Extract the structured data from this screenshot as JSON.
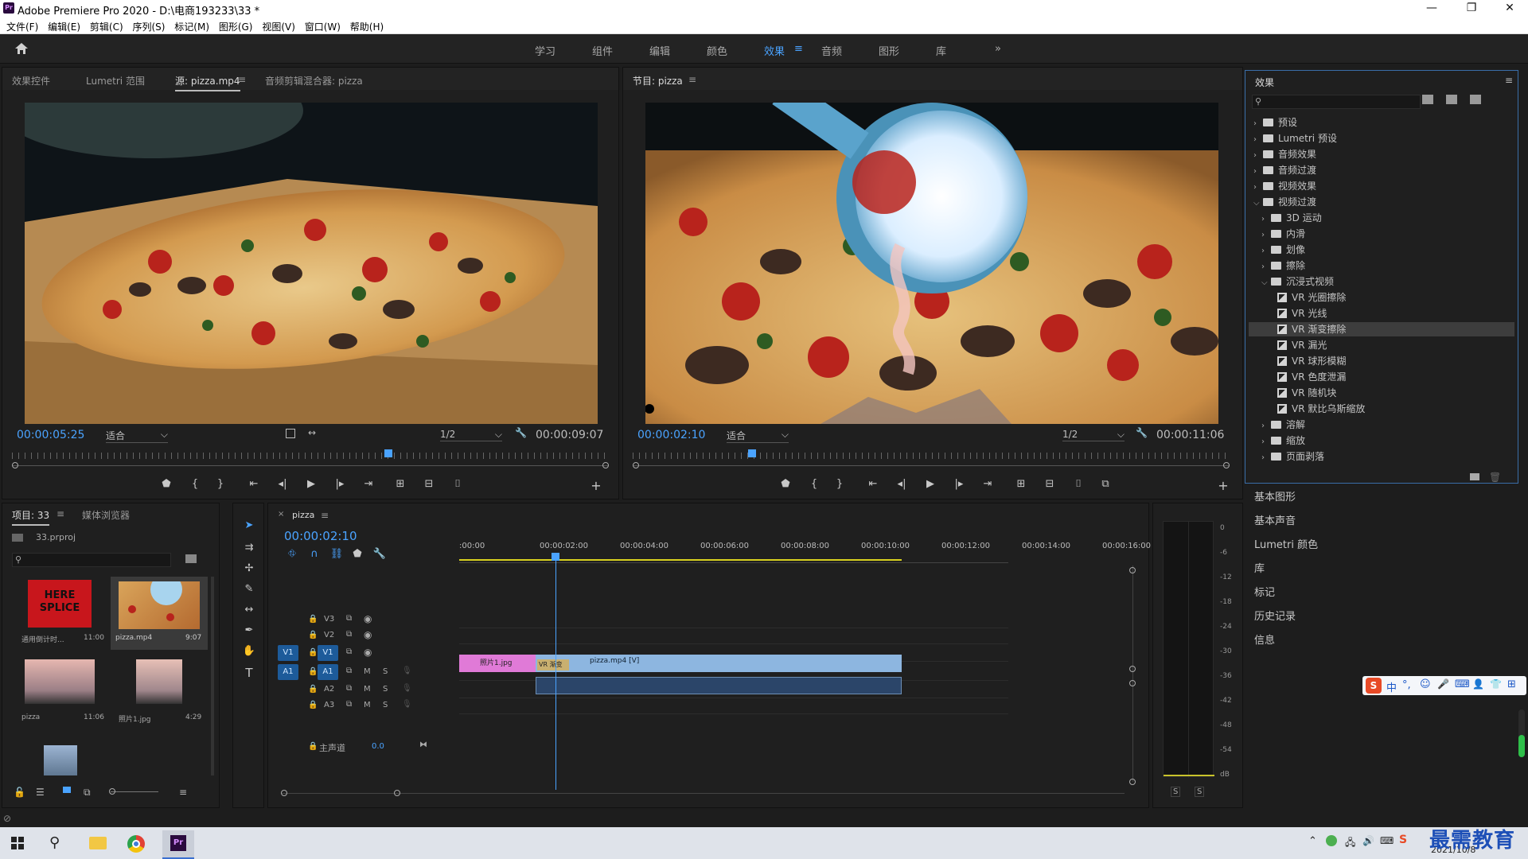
{
  "window": {
    "title": "Adobe Premiere Pro 2020 - D:\\电商193233\\33 *",
    "logo_text": "Pr",
    "controls": [
      "—",
      "❐",
      "✕"
    ]
  },
  "menu": [
    "文件(F)",
    "编辑(E)",
    "剪辑(C)",
    "序列(S)",
    "标记(M)",
    "图形(G)",
    "视图(V)",
    "窗口(W)",
    "帮助(H)"
  ],
  "workspaces": {
    "items": [
      "学习",
      "组件",
      "编辑",
      "颜色",
      "效果",
      "音频",
      "图形",
      "库"
    ],
    "active": "效果",
    "more": "»"
  },
  "source_panel": {
    "tabs": [
      "效果控件",
      "Lumetri 范围",
      "源: pizza.mp4",
      "音频剪辑混合器: pizza"
    ],
    "active_tab": "源: pizza.mp4",
    "timecode": "00:00:05:25",
    "fit": "适合",
    "resolution": "1/2",
    "duration": "00:00:09:07",
    "playhead_fraction": 0.63
  },
  "program_panel": {
    "tab": "节目: pizza",
    "timecode": "00:00:02:10",
    "fit": "适合",
    "resolution": "1/2",
    "duration": "00:00:11:06",
    "playhead_fraction": 0.2
  },
  "effects_panel": {
    "title": "效果",
    "search_placeholder": "",
    "tree": [
      {
        "label": "预设",
        "level": 0,
        "type": "folder-special",
        "open": false
      },
      {
        "label": "Lumetri 预设",
        "level": 0,
        "type": "folder-special",
        "open": false
      },
      {
        "label": "音频效果",
        "level": 0,
        "type": "folder",
        "open": false
      },
      {
        "label": "音频过渡",
        "level": 0,
        "type": "folder",
        "open": false
      },
      {
        "label": "视频效果",
        "level": 0,
        "type": "folder",
        "open": false
      },
      {
        "label": "视频过渡",
        "level": 0,
        "type": "folder",
        "open": true
      },
      {
        "label": "3D 运动",
        "level": 1,
        "type": "folder",
        "open": false
      },
      {
        "label": "内滑",
        "level": 1,
        "type": "folder",
        "open": false
      },
      {
        "label": "划像",
        "level": 1,
        "type": "folder",
        "open": false
      },
      {
        "label": "擦除",
        "level": 1,
        "type": "folder",
        "open": false
      },
      {
        "label": "沉浸式视频",
        "level": 1,
        "type": "folder",
        "open": true
      },
      {
        "label": "VR 光圈擦除",
        "level": 2,
        "type": "effect"
      },
      {
        "label": "VR 光线",
        "level": 2,
        "type": "effect"
      },
      {
        "label": "VR 渐变擦除",
        "level": 2,
        "type": "effect",
        "selected": true
      },
      {
        "label": "VR 漏光",
        "level": 2,
        "type": "effect"
      },
      {
        "label": "VR 球形模糊",
        "level": 2,
        "type": "effect"
      },
      {
        "label": "VR 色度泄漏",
        "level": 2,
        "type": "effect"
      },
      {
        "label": "VR 随机块",
        "level": 2,
        "type": "effect"
      },
      {
        "label": "VR 默比乌斯缩放",
        "level": 2,
        "type": "effect"
      },
      {
        "label": "溶解",
        "level": 1,
        "type": "folder",
        "open": false
      },
      {
        "label": "缩放",
        "level": 1,
        "type": "folder",
        "open": false
      },
      {
        "label": "页面剥落",
        "level": 1,
        "type": "folder",
        "open": false
      }
    ]
  },
  "side_panels": [
    "基本图形",
    "基本声音",
    "Lumetri 颜色",
    "库",
    "标记",
    "历史记录",
    "信息"
  ],
  "project_panel": {
    "tabs": [
      "项目: 33",
      "媒体浏览器"
    ],
    "project_file": "33.prproj",
    "items": [
      {
        "name": "通用倒计时...",
        "duration": "11:00",
        "thumb": "countdown",
        "thumb_text": "HERE SPLICE"
      },
      {
        "name": "pizza.mp4",
        "duration": "9:07",
        "thumb": "pizza"
      },
      {
        "name": "pizza",
        "duration": "11:06",
        "thumb": "sky"
      },
      {
        "name": "照片1.jpg",
        "duration": "4:29",
        "thumb": "sky2"
      },
      {
        "name": "",
        "duration": "",
        "thumb": "sky3"
      }
    ]
  },
  "timeline": {
    "tab": "pizza",
    "close": "×",
    "timecode": "00:00:02:10",
    "ruler": [
      ":00:00",
      "00:00:02:00",
      "00:00:04:00",
      "00:00:06:00",
      "00:00:08:00",
      "00:00:10:00",
      "00:00:12:00",
      "00:00:14:00",
      "00:00:16:00"
    ],
    "tracks": [
      {
        "id": "V3",
        "label": "V3",
        "kind": "video"
      },
      {
        "id": "V2",
        "label": "V2",
        "kind": "video"
      },
      {
        "id": "V1",
        "label": "V1",
        "kind": "video",
        "source": "V1"
      },
      {
        "id": "A1",
        "label": "A1",
        "kind": "audio",
        "source": "A1"
      },
      {
        "id": "A2",
        "label": "A2",
        "kind": "audio"
      },
      {
        "id": "A3",
        "label": "A3",
        "kind": "audio"
      }
    ],
    "master": {
      "label": "主声道",
      "value": "0.0"
    },
    "clips": {
      "photo": "照片1.jpg",
      "transition": "VR 渐变",
      "video": "pizza.mp4 [V]"
    },
    "m_label": "M",
    "s_label": "S"
  },
  "meters": {
    "scale": [
      "0",
      "-6",
      "-12",
      "-18",
      "-24",
      "-30",
      "-36",
      "-42",
      "-48",
      "-54",
      "dB"
    ],
    "solo": [
      "S",
      "S"
    ]
  },
  "ime_bar": {
    "items": [
      "S",
      "中",
      "°,",
      "☺",
      "🎤",
      "⌨",
      "👤",
      "👕",
      "⊞"
    ]
  },
  "taskbar": {
    "date": "2021/10/8",
    "watermark": "最需教育"
  },
  "colors": {
    "accent": "#4aa3ff",
    "photo_clip": "#e07ad7",
    "video_clip": "#8db6e0",
    "transition": "#c9b070",
    "track_on": "#1d5b9a"
  }
}
